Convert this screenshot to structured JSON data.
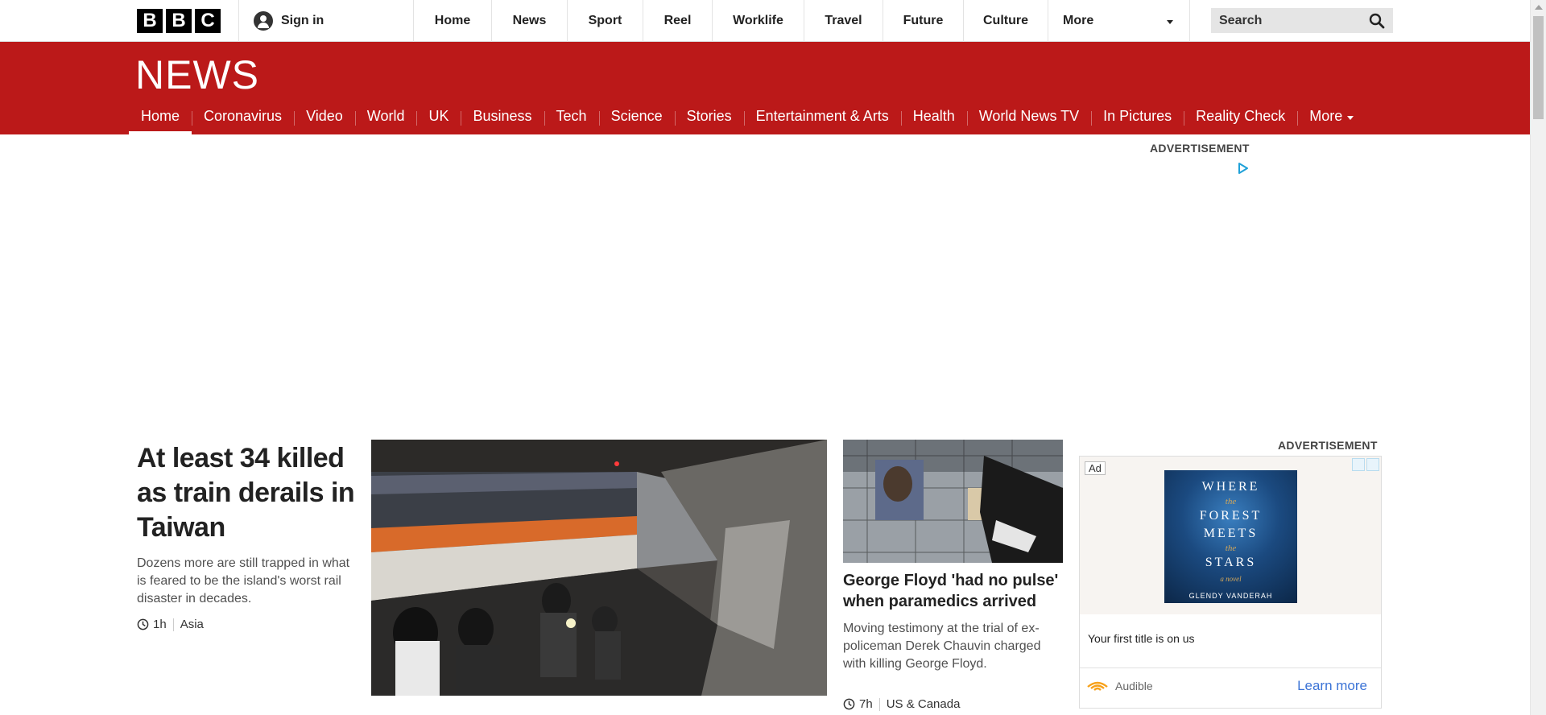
{
  "global": {
    "logo_letters": [
      "B",
      "B",
      "C"
    ],
    "signin_label": "Sign in",
    "nav": [
      "Home",
      "News",
      "Sport",
      "Reel",
      "Worklife",
      "Travel",
      "Future",
      "Culture"
    ],
    "more_label": "More",
    "search_placeholder": "Search"
  },
  "news": {
    "wordmark": "NEWS",
    "nav": [
      "Home",
      "Coronavirus",
      "Video",
      "World",
      "UK",
      "Business",
      "Tech",
      "Science",
      "Stories",
      "Entertainment & Arts",
      "Health",
      "World News TV",
      "In Pictures",
      "Reality Check"
    ],
    "active_item": "Home",
    "more_label": "More",
    "brand_color": "#bb1919"
  },
  "ad_top": {
    "label": "ADVERTISEMENT"
  },
  "lead_story": {
    "headline": "At least 34 killed as train derails in Taiwan",
    "summary": "Dozens more are still trapped in what is feared to be the island's worst rail disaster in decades.",
    "time": "1h",
    "section": "Asia"
  },
  "second_story": {
    "headline": "George Floyd 'had no pulse' when paramedics arrived",
    "summary": "Moving testimony at the trial of ex-policeman Derek Chauvin charged with killing George Floyd.",
    "time": "7h",
    "section": "US & Canada"
  },
  "ad_side": {
    "label": "ADVERTISEMENT",
    "ad_tag": "Ad",
    "book_title_lines": [
      "WHERE",
      "the",
      "FOREST",
      "MEETS",
      "the",
      "STARS"
    ],
    "book_tagline": "a novel",
    "book_author": "GLENDY VANDERAH",
    "text": "Your first title is on us",
    "brand": "Audible",
    "cta": "Learn more"
  }
}
